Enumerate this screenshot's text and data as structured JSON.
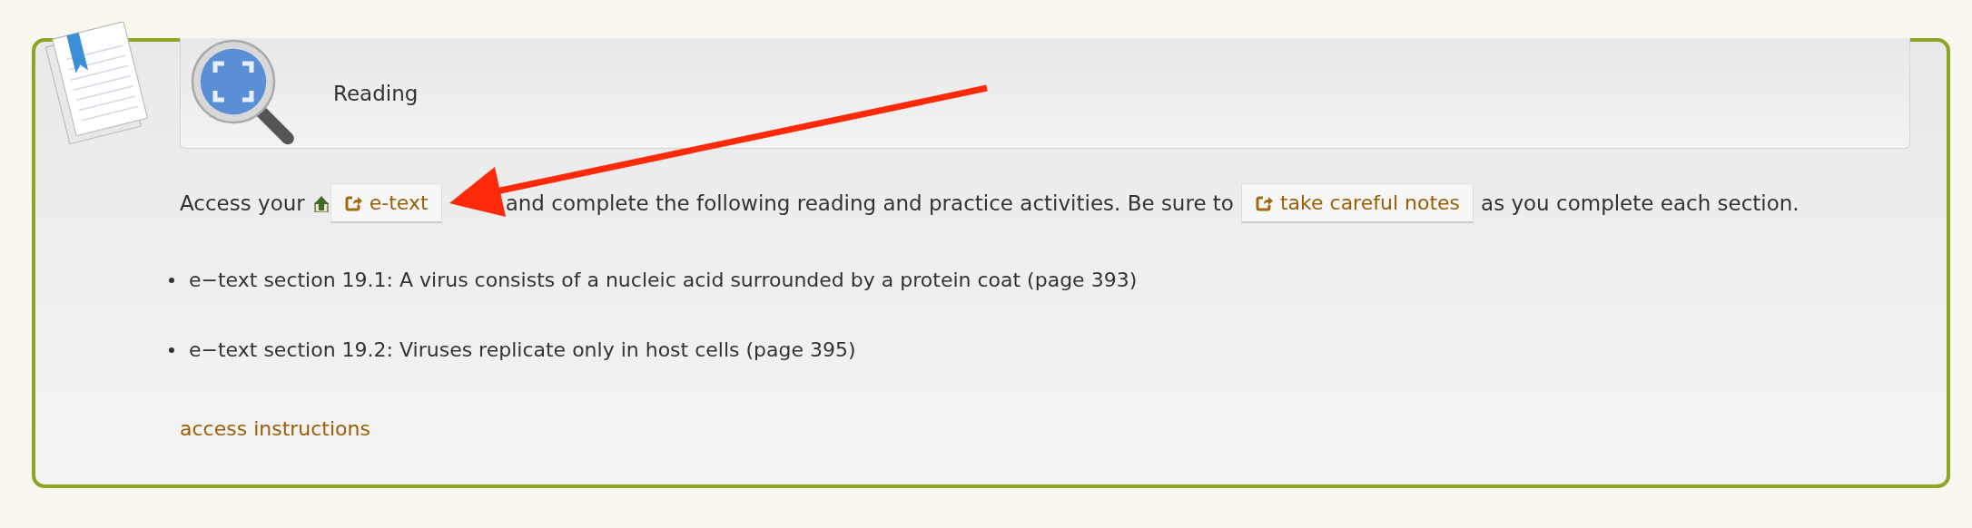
{
  "section": {
    "title": "Reading"
  },
  "intro": {
    "before": "Access your",
    "etext_button": "e-text",
    "middle": "and complete the following reading and practice activities. Be sure to",
    "notes_button": "take careful notes",
    "after": "as you complete each section."
  },
  "items": [
    "e−text section 19.1: A virus consists of a nucleic acid surrounded by a protein coat (page 393)",
    "e−text section 19.2: Viruses replicate only in host cells (page 395)"
  ],
  "link": "access instructions"
}
